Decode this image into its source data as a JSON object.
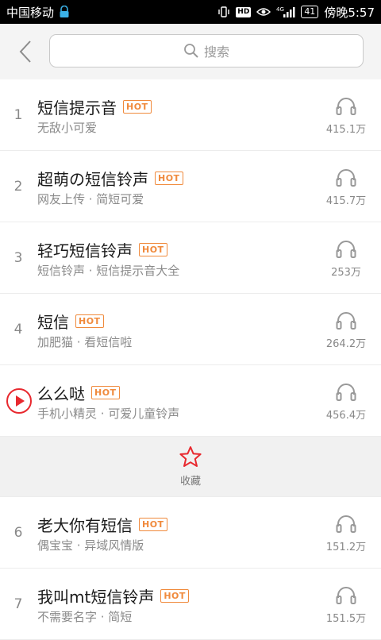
{
  "status_bar": {
    "carrier": "中国移动",
    "network": "4G",
    "battery": "41",
    "time": "傍晚5:57"
  },
  "header": {
    "back_icon": "chevron-left-icon",
    "search_placeholder": "搜索"
  },
  "hot_badge": "HOT",
  "songs": [
    {
      "rank": "1",
      "title": "短信提示音",
      "subtitle": "无敌小可爱",
      "plays": "415.1万"
    },
    {
      "rank": "2",
      "title": "超萌の短信铃声",
      "subtitle": "网友上传 · 简短可爱",
      "plays": "415.7万"
    },
    {
      "rank": "3",
      "title": "轻巧短信铃声",
      "subtitle": "短信铃声 · 短信提示音大全",
      "plays": "253万"
    },
    {
      "rank": "4",
      "title": "短信",
      "subtitle": "加肥猫 · 看短信啦",
      "plays": "264.2万"
    },
    {
      "rank": "5",
      "title": "么么哒",
      "subtitle": "手机小精灵 · 可爱儿童铃声",
      "plays": "456.4万",
      "playing": true
    },
    {
      "rank": "6",
      "title": "老大你有短信",
      "subtitle": "偶宝宝 · 异域风情版",
      "plays": "151.2万"
    },
    {
      "rank": "7",
      "title": "我叫mt短信铃声",
      "subtitle": "不需要名字 · 简短",
      "plays": "151.5万"
    }
  ],
  "collect": {
    "label": "收藏",
    "icon": "star-outline-icon"
  },
  "colors": {
    "accent": "#f08a3c",
    "play_red": "#e8292f",
    "text_secondary": "#8a8a8a"
  }
}
